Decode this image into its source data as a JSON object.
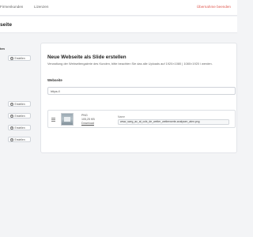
{
  "nav": {
    "firmenkunden": "Firmenkunden",
    "lizenzen": "Lizenzen",
    "takeover": "Übernahme beenden"
  },
  "page": {
    "title": "seite"
  },
  "left": {
    "section_label": "ten",
    "create_label": "Erstellen"
  },
  "card": {
    "title": "Neue Webseite als Slide erstellen",
    "description": "Verwaltung der Webseitengalerie des Kunden, bitte beachten Sie das alle Uploads auf 1920×1080 | 1080×1920 i werden.",
    "url_label": "Webseite",
    "url_value": "https://",
    "attachment": {
      "type": "PNG",
      "size": "105,25 KB",
      "download": "Download",
      "name_label": "Name",
      "name_value": "www_swrg_ac_at_cols_de_wetter_wetterwerte-analysen_aten.png"
    }
  },
  "colors": {
    "takeover": "#e0584f",
    "background": "#f3f4f6",
    "card": "#ffffff"
  },
  "icons": [
    "plus-circle-icon",
    "drag-handle-icon"
  ]
}
